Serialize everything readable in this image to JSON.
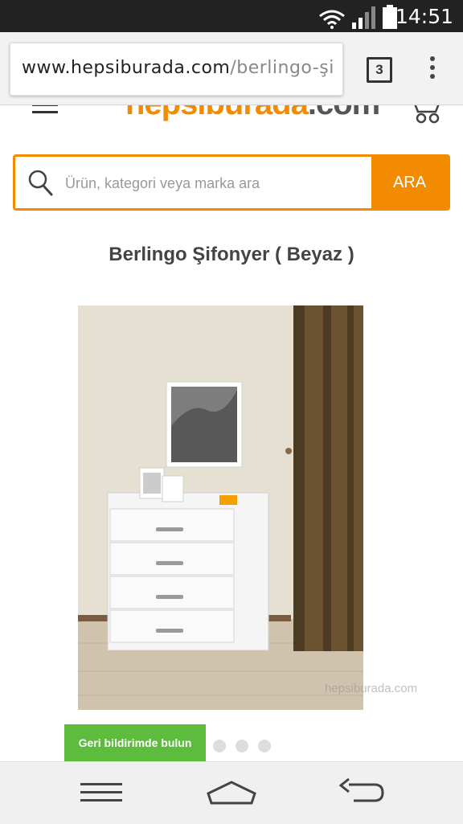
{
  "status_bar": {
    "time": "14:51",
    "icons": [
      "wifi-icon",
      "signal-icon",
      "battery-icon"
    ]
  },
  "browser": {
    "url_host": "www.hepsiburada.com",
    "url_path": "/berlingo-şi",
    "tab_count": "3"
  },
  "site": {
    "logo_main": "hepsiburada",
    "logo_suffix": ".com",
    "search": {
      "placeholder": "Ürün, kategori veya marka ara",
      "button_label": "ARA"
    }
  },
  "product": {
    "title": "Berlingo Şifonyer ( Beyaz )",
    "image_watermark": "hepsiburada.com",
    "feedback_label": "Geri bildirimde bulun",
    "gallery_dots": 3,
    "active_dot": 0
  },
  "colors": {
    "brand_orange": "#f28b00",
    "feedback_green": "#5dbb3e"
  }
}
